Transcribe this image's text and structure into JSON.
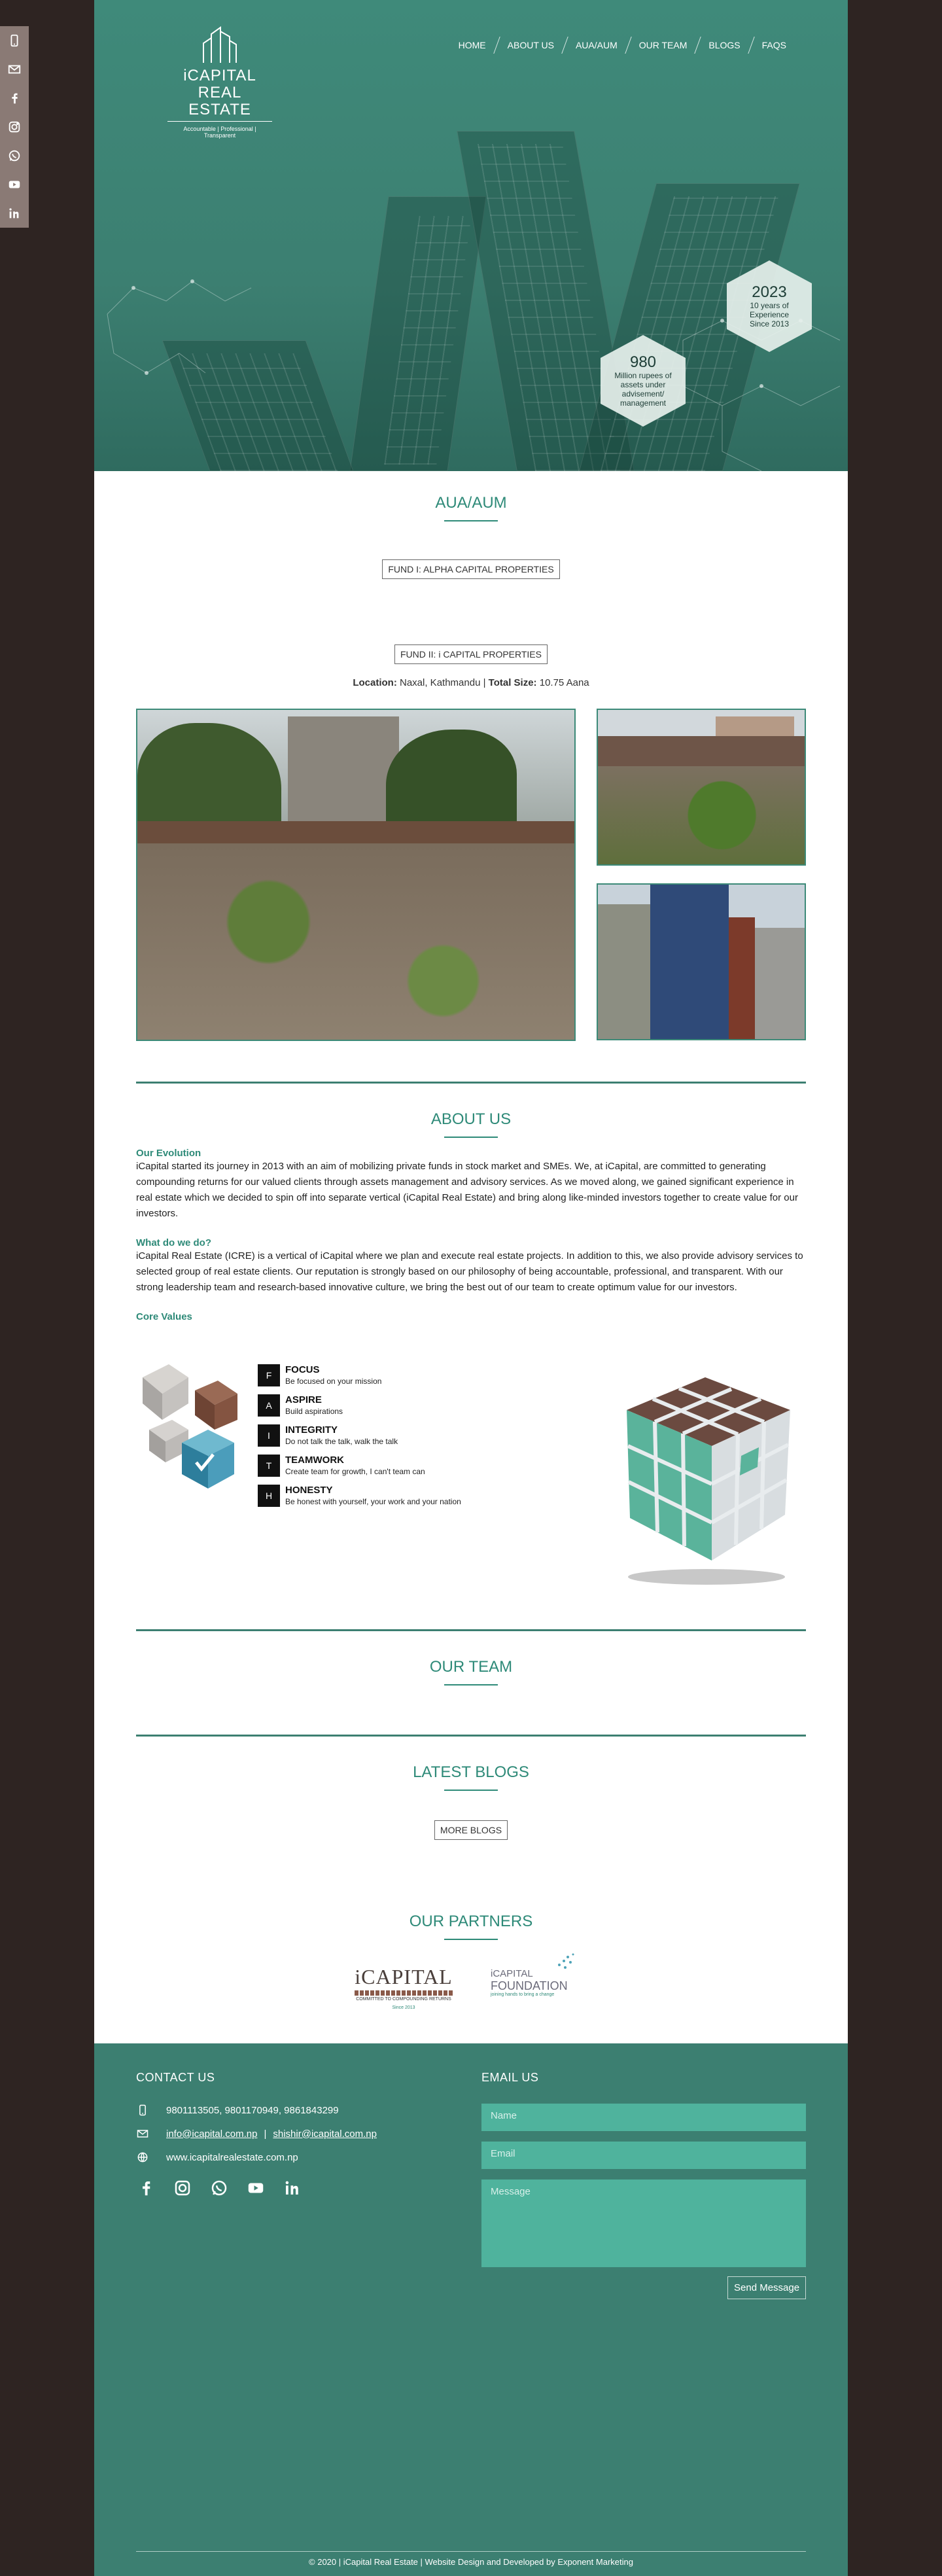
{
  "social_rail": [
    "phone-icon",
    "mail-icon",
    "facebook-icon",
    "instagram-icon",
    "whatsapp-icon",
    "youtube-icon",
    "linkedin-icon"
  ],
  "logo": {
    "line1": "iCAPITAL",
    "line2": "REAL ESTATE",
    "tagline": "Accountable | Professional | Transparent"
  },
  "nav": [
    "HOME",
    "ABOUT US",
    "AUA/AUM",
    "OUR TEAM",
    "BLOGS",
    "FAQS"
  ],
  "hero_stats": [
    {
      "big": "2023",
      "small": "10 years of Experience Since 2013"
    },
    {
      "big": "980",
      "small": "Million rupees of assets under advisement/ management"
    }
  ],
  "aua": {
    "title": "AUA/AUM",
    "fund1": "FUND I: ALPHA CAPITAL PROPERTIES",
    "fund2": "FUND II: i CAPITAL PROPERTIES",
    "location_label": "Location:",
    "location_value": "Naxal, Kathmandu",
    "size_label": "Total Size:",
    "size_value": "10.75 Aana"
  },
  "about": {
    "title": "ABOUT US",
    "evolution_h": "Our Evolution",
    "evolution_p": "iCapital started its journey in 2013 with an aim of mobilizing private funds in stock market and SMEs. We, at iCapital, are committed to generating compounding returns for our valued clients through assets management and advisory services. As we moved along, we gained significant experience in real estate which we decided to spin off into separate vertical (iCapital Real Estate) and bring along like-minded investors together to create value for our investors.",
    "whatdo_h": "What do we do?",
    "whatdo_p": "iCapital Real Estate (ICRE) is a vertical of iCapital where we plan and execute real estate projects. In addition to this, we also provide advisory services to selected group of real estate clients. Our reputation is strongly based on our philosophy of being accountable, professional, and transparent. With our strong leadership team and research-based innovative culture, we bring the best out of our team to create optimum value for our investors.",
    "core_h": "Core Values",
    "values": [
      {
        "letter": "F",
        "title": "FOCUS",
        "desc": "Be focused on your mission"
      },
      {
        "letter": "A",
        "title": "ASPIRE",
        "desc": "Build aspirations"
      },
      {
        "letter": "I",
        "title": "INTEGRITY",
        "desc": "Do not talk the talk, walk the talk"
      },
      {
        "letter": "T",
        "title": "TEAMWORK",
        "desc": "Create team for growth, I can't team can"
      },
      {
        "letter": "H",
        "title": "HONESTY",
        "desc": "Be honest with yourself, your work and your nation"
      }
    ]
  },
  "team": {
    "title": "OUR TEAM"
  },
  "blogs": {
    "title": "LATEST BLOGS",
    "more": "MORE BLOGS"
  },
  "partners": {
    "title": "OUR PARTNERS",
    "p1_name": "iCAPITAL",
    "p1_sub": "COMMITTED TO COMPOUNDING RETURNS",
    "p1_since": "Since 2013",
    "p2_line1": "iCAPITAL",
    "p2_line2": "FOUNDATION",
    "p2_sub": "joining hands to bring a change"
  },
  "contact": {
    "title": "CONTACT US",
    "phones": "9801113505, 9801170949, 9861843299",
    "email1": "info@icapital.com.np",
    "email_sep": "|",
    "email2": "shishir@icapital.com.np",
    "website": "www.icapitalrealestate.com.np",
    "socials": [
      "facebook-icon",
      "instagram-icon",
      "whatsapp-icon",
      "youtube-icon",
      "linkedin-icon"
    ]
  },
  "email_form": {
    "title": "EMAIL US",
    "name_ph": "Name",
    "email_ph": "Email",
    "message_ph": "Message",
    "send": "Send Message"
  },
  "copyright": "© 2020 | iCapital Real Estate | Website Design and Developed by Exponent Marketing"
}
